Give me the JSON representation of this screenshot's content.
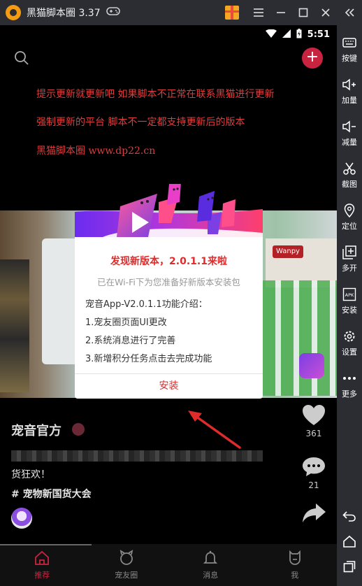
{
  "emulator": {
    "title": "黑猫脚本圈 3.37",
    "sidebar": [
      {
        "label": "按键",
        "icon": "keyboard-icon"
      },
      {
        "label": "加量",
        "icon": "volume-up-icon"
      },
      {
        "label": "减量",
        "icon": "volume-down-icon"
      },
      {
        "label": "截图",
        "icon": "scissors-icon"
      },
      {
        "label": "定位",
        "icon": "location-pin-icon"
      },
      {
        "label": "多开",
        "icon": "multi-instance-icon"
      },
      {
        "label": "安装",
        "icon": "apk-install-icon"
      },
      {
        "label": "设置",
        "icon": "gear-icon"
      },
      {
        "label": "更多",
        "icon": "more-dots-icon"
      }
    ]
  },
  "status": {
    "time": "5:51"
  },
  "notice": {
    "line1": "提示更新就更新吧  如果脚本不正常在联系黑猫进行更新",
    "line2": "强制更新的平台 脚本不一定都支持更新后的版本",
    "line3": "黑猫脚本圈 www.dp22.cn"
  },
  "post": {
    "author": "宠音官方",
    "caption": "货狂欢！",
    "hashtag": "# 宠物新国货大会",
    "likes": "361",
    "comments": "21"
  },
  "video": {
    "brand": "Wanpy"
  },
  "dialog": {
    "title": "发现新版本，2.0.1.1来啦",
    "subtitle": "已在Wi-Fi下为您准备好新版本安装包",
    "intro": "宠音App-V2.0.1.1功能介绍：",
    "items": [
      "1.宠友圈页面UI更改",
      "2.系统消息进行了完善",
      "3.新增积分任务点击去完成功能"
    ],
    "install": "安装"
  },
  "nav": [
    {
      "label": "推荐",
      "active": true
    },
    {
      "label": "宠友圈",
      "active": false
    },
    {
      "label": "消息",
      "active": false
    },
    {
      "label": "我",
      "active": false
    }
  ],
  "colors": {
    "accent": "#c9243f",
    "dialog_red": "#e02b2b",
    "notice_red": "#e13c3c"
  }
}
